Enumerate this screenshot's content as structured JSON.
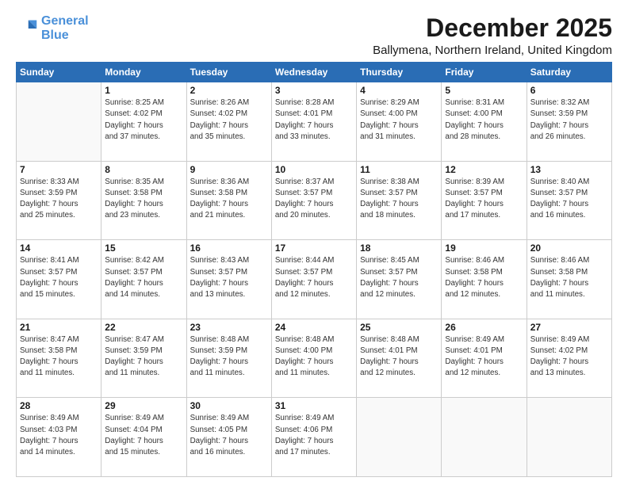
{
  "logo": {
    "line1": "General",
    "line2": "Blue"
  },
  "header": {
    "month": "December 2025",
    "location": "Ballymena, Northern Ireland, United Kingdom"
  },
  "weekdays": [
    "Sunday",
    "Monday",
    "Tuesday",
    "Wednesday",
    "Thursday",
    "Friday",
    "Saturday"
  ],
  "weeks": [
    [
      {
        "day": "",
        "info": ""
      },
      {
        "day": "1",
        "info": "Sunrise: 8:25 AM\nSunset: 4:02 PM\nDaylight: 7 hours\nand 37 minutes."
      },
      {
        "day": "2",
        "info": "Sunrise: 8:26 AM\nSunset: 4:02 PM\nDaylight: 7 hours\nand 35 minutes."
      },
      {
        "day": "3",
        "info": "Sunrise: 8:28 AM\nSunset: 4:01 PM\nDaylight: 7 hours\nand 33 minutes."
      },
      {
        "day": "4",
        "info": "Sunrise: 8:29 AM\nSunset: 4:00 PM\nDaylight: 7 hours\nand 31 minutes."
      },
      {
        "day": "5",
        "info": "Sunrise: 8:31 AM\nSunset: 4:00 PM\nDaylight: 7 hours\nand 28 minutes."
      },
      {
        "day": "6",
        "info": "Sunrise: 8:32 AM\nSunset: 3:59 PM\nDaylight: 7 hours\nand 26 minutes."
      }
    ],
    [
      {
        "day": "7",
        "info": "Sunrise: 8:33 AM\nSunset: 3:59 PM\nDaylight: 7 hours\nand 25 minutes."
      },
      {
        "day": "8",
        "info": "Sunrise: 8:35 AM\nSunset: 3:58 PM\nDaylight: 7 hours\nand 23 minutes."
      },
      {
        "day": "9",
        "info": "Sunrise: 8:36 AM\nSunset: 3:58 PM\nDaylight: 7 hours\nand 21 minutes."
      },
      {
        "day": "10",
        "info": "Sunrise: 8:37 AM\nSunset: 3:57 PM\nDaylight: 7 hours\nand 20 minutes."
      },
      {
        "day": "11",
        "info": "Sunrise: 8:38 AM\nSunset: 3:57 PM\nDaylight: 7 hours\nand 18 minutes."
      },
      {
        "day": "12",
        "info": "Sunrise: 8:39 AM\nSunset: 3:57 PM\nDaylight: 7 hours\nand 17 minutes."
      },
      {
        "day": "13",
        "info": "Sunrise: 8:40 AM\nSunset: 3:57 PM\nDaylight: 7 hours\nand 16 minutes."
      }
    ],
    [
      {
        "day": "14",
        "info": "Sunrise: 8:41 AM\nSunset: 3:57 PM\nDaylight: 7 hours\nand 15 minutes."
      },
      {
        "day": "15",
        "info": "Sunrise: 8:42 AM\nSunset: 3:57 PM\nDaylight: 7 hours\nand 14 minutes."
      },
      {
        "day": "16",
        "info": "Sunrise: 8:43 AM\nSunset: 3:57 PM\nDaylight: 7 hours\nand 13 minutes."
      },
      {
        "day": "17",
        "info": "Sunrise: 8:44 AM\nSunset: 3:57 PM\nDaylight: 7 hours\nand 12 minutes."
      },
      {
        "day": "18",
        "info": "Sunrise: 8:45 AM\nSunset: 3:57 PM\nDaylight: 7 hours\nand 12 minutes."
      },
      {
        "day": "19",
        "info": "Sunrise: 8:46 AM\nSunset: 3:58 PM\nDaylight: 7 hours\nand 12 minutes."
      },
      {
        "day": "20",
        "info": "Sunrise: 8:46 AM\nSunset: 3:58 PM\nDaylight: 7 hours\nand 11 minutes."
      }
    ],
    [
      {
        "day": "21",
        "info": "Sunrise: 8:47 AM\nSunset: 3:58 PM\nDaylight: 7 hours\nand 11 minutes."
      },
      {
        "day": "22",
        "info": "Sunrise: 8:47 AM\nSunset: 3:59 PM\nDaylight: 7 hours\nand 11 minutes."
      },
      {
        "day": "23",
        "info": "Sunrise: 8:48 AM\nSunset: 3:59 PM\nDaylight: 7 hours\nand 11 minutes."
      },
      {
        "day": "24",
        "info": "Sunrise: 8:48 AM\nSunset: 4:00 PM\nDaylight: 7 hours\nand 11 minutes."
      },
      {
        "day": "25",
        "info": "Sunrise: 8:48 AM\nSunset: 4:01 PM\nDaylight: 7 hours\nand 12 minutes."
      },
      {
        "day": "26",
        "info": "Sunrise: 8:49 AM\nSunset: 4:01 PM\nDaylight: 7 hours\nand 12 minutes."
      },
      {
        "day": "27",
        "info": "Sunrise: 8:49 AM\nSunset: 4:02 PM\nDaylight: 7 hours\nand 13 minutes."
      }
    ],
    [
      {
        "day": "28",
        "info": "Sunrise: 8:49 AM\nSunset: 4:03 PM\nDaylight: 7 hours\nand 14 minutes."
      },
      {
        "day": "29",
        "info": "Sunrise: 8:49 AM\nSunset: 4:04 PM\nDaylight: 7 hours\nand 15 minutes."
      },
      {
        "day": "30",
        "info": "Sunrise: 8:49 AM\nSunset: 4:05 PM\nDaylight: 7 hours\nand 16 minutes."
      },
      {
        "day": "31",
        "info": "Sunrise: 8:49 AM\nSunset: 4:06 PM\nDaylight: 7 hours\nand 17 minutes."
      },
      {
        "day": "",
        "info": ""
      },
      {
        "day": "",
        "info": ""
      },
      {
        "day": "",
        "info": ""
      }
    ]
  ]
}
